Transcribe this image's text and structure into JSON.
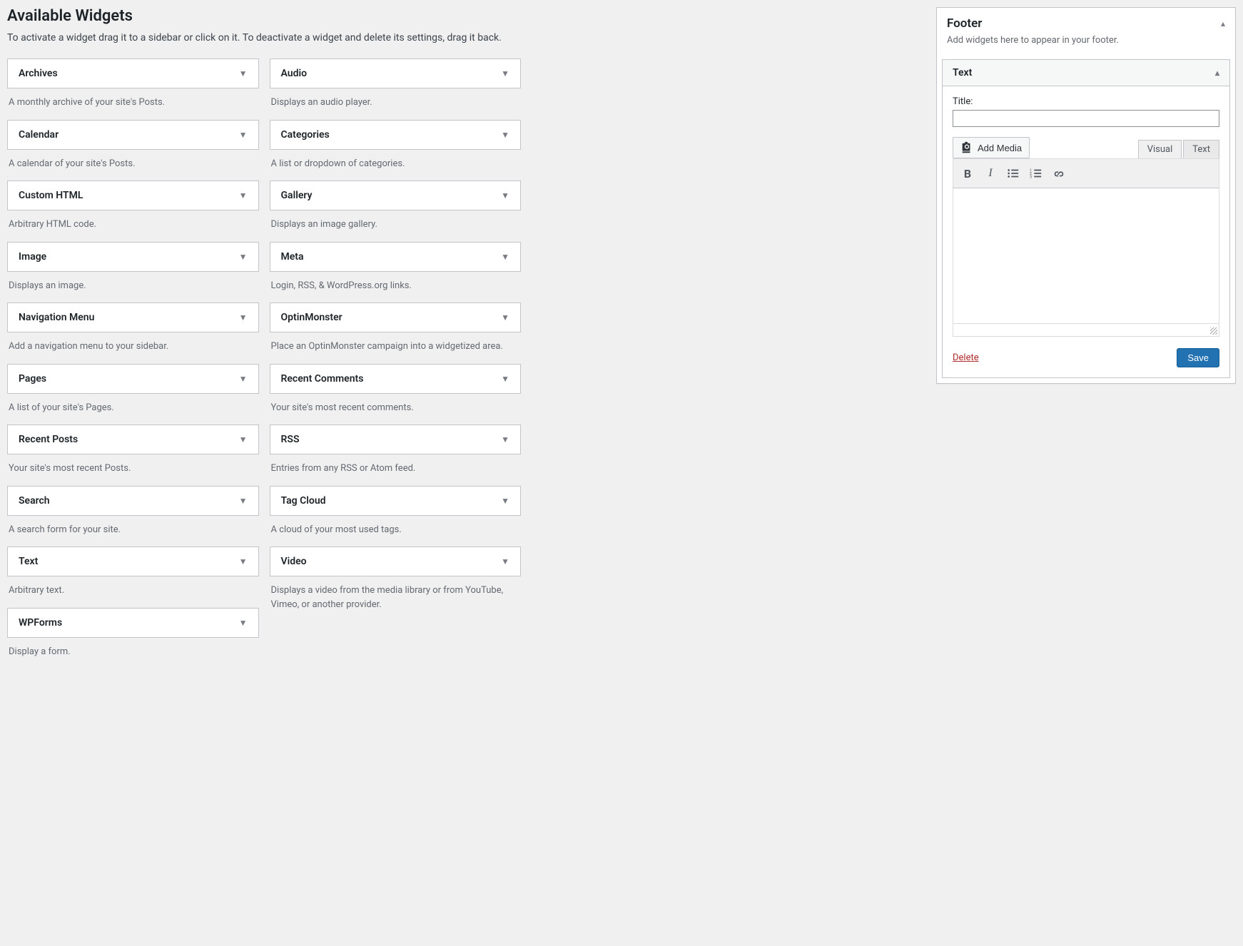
{
  "available": {
    "heading": "Available Widgets",
    "desc": "To activate a widget drag it to a sidebar or click on it. To deactivate a widget and delete its settings, drag it back."
  },
  "widgets_left": [
    {
      "title": "Archives",
      "desc": "A monthly archive of your site's Posts."
    },
    {
      "title": "Calendar",
      "desc": "A calendar of your site's Posts."
    },
    {
      "title": "Custom HTML",
      "desc": "Arbitrary HTML code."
    },
    {
      "title": "Image",
      "desc": "Displays an image."
    },
    {
      "title": "Navigation Menu",
      "desc": "Add a navigation menu to your sidebar."
    },
    {
      "title": "Pages",
      "desc": "A list of your site's Pages."
    },
    {
      "title": "Recent Posts",
      "desc": "Your site's most recent Posts."
    },
    {
      "title": "Search",
      "desc": "A search form for your site."
    },
    {
      "title": "Text",
      "desc": "Arbitrary text."
    },
    {
      "title": "WPForms",
      "desc": "Display a form."
    }
  ],
  "widgets_right": [
    {
      "title": "Audio",
      "desc": "Displays an audio player."
    },
    {
      "title": "Categories",
      "desc": "A list or dropdown of categories."
    },
    {
      "title": "Gallery",
      "desc": "Displays an image gallery."
    },
    {
      "title": "Meta",
      "desc": "Login, RSS, & WordPress.org links."
    },
    {
      "title": "OptinMonster",
      "desc": "Place an OptinMonster campaign into a widgetized area."
    },
    {
      "title": "Recent Comments",
      "desc": "Your site's most recent comments."
    },
    {
      "title": "RSS",
      "desc": "Entries from any RSS or Atom feed."
    },
    {
      "title": "Tag Cloud",
      "desc": "A cloud of your most used tags."
    },
    {
      "title": "Video",
      "desc": "Displays a video from the media library or from YouTube, Vimeo, or another provider."
    }
  ],
  "footer": {
    "title": "Footer",
    "desc": "Add widgets here to appear in your footer.",
    "widget": {
      "name": "Text",
      "title_label": "Title:",
      "add_media": "Add Media",
      "tab_visual": "Visual",
      "tab_text": "Text",
      "delete": "Delete",
      "save": "Save"
    }
  }
}
